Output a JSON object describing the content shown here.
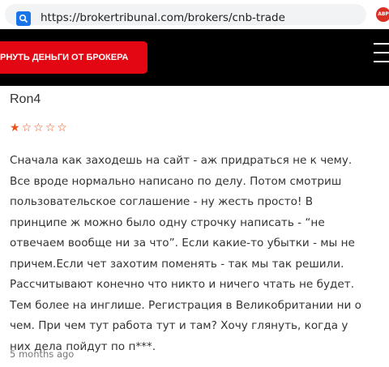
{
  "browser": {
    "url": "https://brokertribunal.com/brokers/cnb-trade",
    "extension_badge": "ABP",
    "colors": {
      "url_icon": "#1a73e8",
      "extension": "#d93025"
    }
  },
  "header": {
    "cta_label": "РНУТЬ ДЕНЬГИ ОТ БРОКЕРА",
    "colors": {
      "background": "#000000",
      "cta": "#e30613"
    },
    "menu_icon": "hamburger-menu-icon"
  },
  "review": {
    "author": "Ron4",
    "rating": 1,
    "rating_max": 5,
    "text": "Сначала как заходешь на сайт - аж придраться не к чему. Все вроде нормально написано по делу. Потом смотриш пользовательское соглашение - ну жесть просто! В принципе ж можно было одну строчку написать - “не отвечаем вообще ни за что”. Если какие-то убытки - мы не причем.Если чет захотим поменять - так мы так решили. Рассчитывают конечно что никто и ничего чтать не будет. Тем более на инглише. Регистрация в Великобритании ни о чем. При чем тут работа тут и там? Хочу глянуть, когда у них дела пойдут по п***.",
    "time": "5 months ago",
    "star_color": "#e8521e"
  }
}
